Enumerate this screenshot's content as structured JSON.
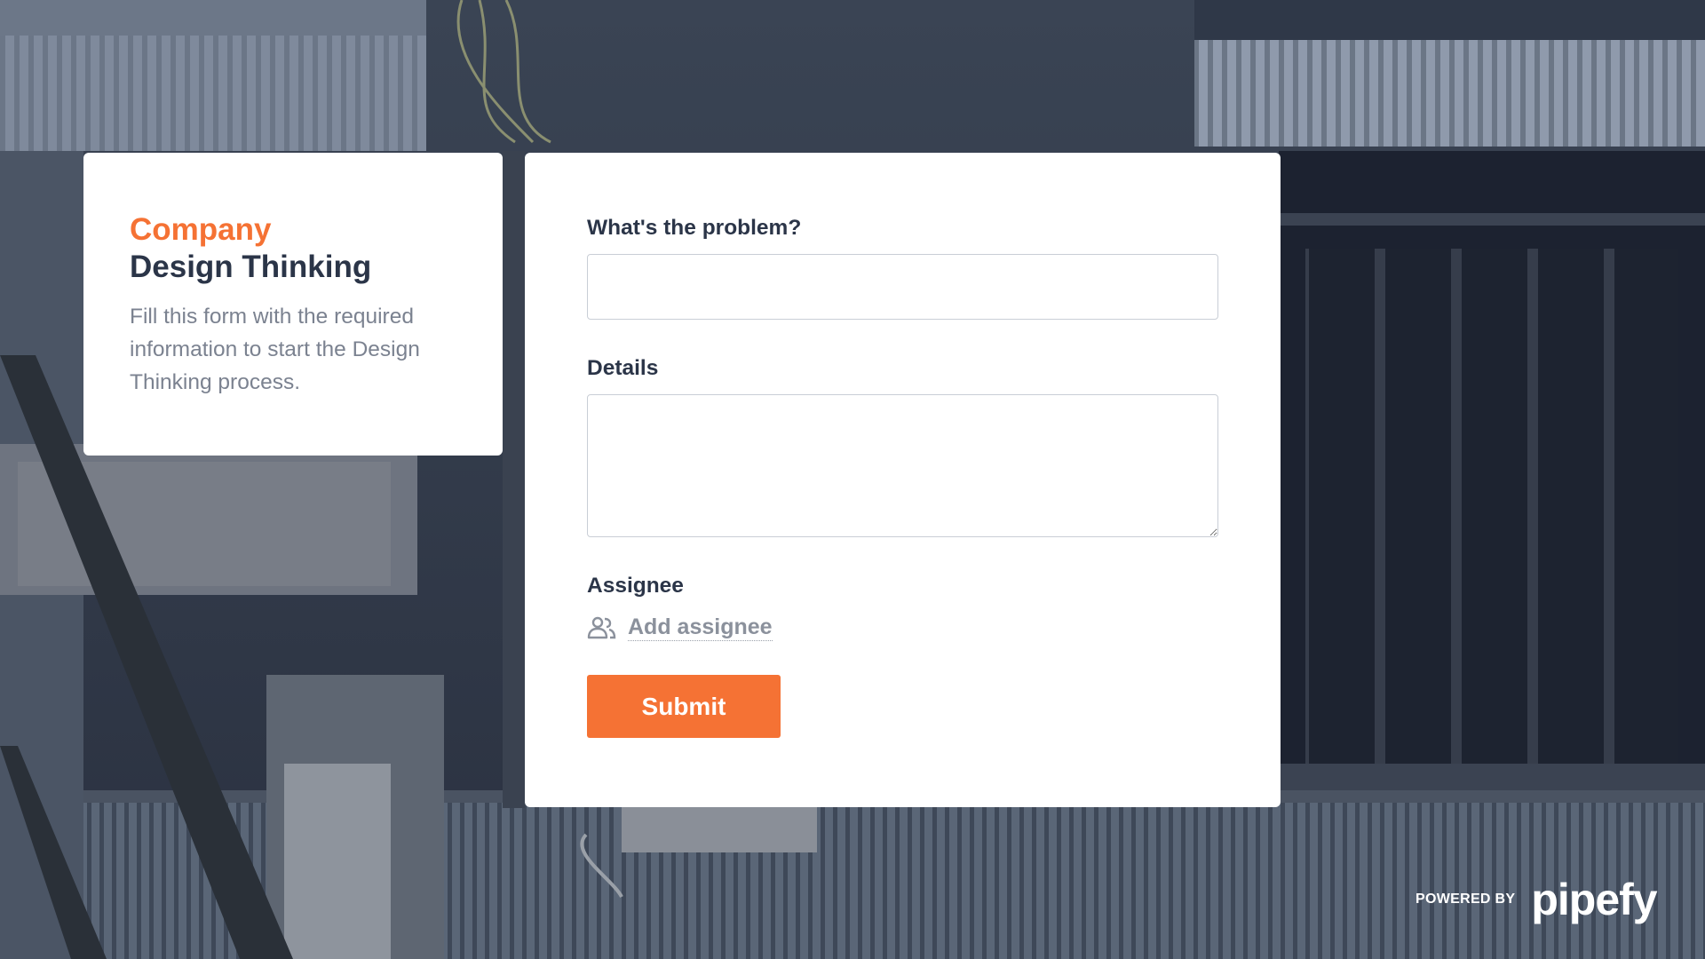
{
  "background": {
    "description_icon": "industrial-photo-background"
  },
  "info": {
    "brand": "Company",
    "title": "Design Thinking",
    "description": "Fill this form with the required information to start the Design Thinking process."
  },
  "form": {
    "problem_label": "What's the problem?",
    "problem_value": "",
    "details_label": "Details",
    "details_value": "",
    "assignee_label": "Assignee",
    "assignee_icon": "people-icon",
    "add_assignee": "Add assignee",
    "submit_label": "Submit"
  },
  "footer": {
    "powered_by": "POWERED BY",
    "logo": "pipefy"
  },
  "colors": {
    "accent": "#f57234",
    "heading": "#2b3548",
    "muted": "#7b8290",
    "card": "#ffffff"
  }
}
